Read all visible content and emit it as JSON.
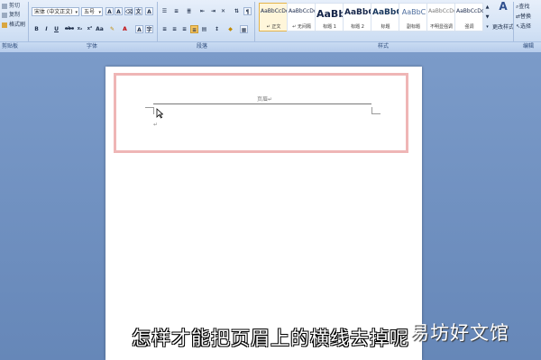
{
  "clipboard": {
    "cut": "剪切",
    "copy": "复制",
    "format_painter": "格式刷",
    "group_label": "剪贴板"
  },
  "font": {
    "family": "宋体 (中文正文)",
    "size": "五号",
    "group_label": "字体",
    "buttons": [
      "B",
      "I",
      "U",
      "abc",
      "x₂",
      "x²",
      "Aa",
      "A",
      "A"
    ]
  },
  "paragraph": {
    "group_label": "段落"
  },
  "styles": {
    "group_label": "样式",
    "items": [
      {
        "sample": "AaBbCcDd",
        "name": "↵ 正文",
        "selected": true
      },
      {
        "sample": "AaBbCcDd",
        "name": "↵ 无间隔",
        "selected": false
      },
      {
        "sample": "AaBb",
        "name": "标题 1",
        "selected": false
      },
      {
        "sample": "AaBbC",
        "name": "标题 2",
        "selected": false
      },
      {
        "sample": "AaBbC",
        "name": "标题",
        "selected": false
      },
      {
        "sample": "AaBbC",
        "name": "副标题",
        "selected": false
      },
      {
        "sample": "AaBbCcDd",
        "name": "不明显强调",
        "selected": false
      },
      {
        "sample": "AaBbCcDd",
        "name": "强调",
        "selected": false
      }
    ],
    "change_styles": "更改样式"
  },
  "editing": {
    "find": "查找",
    "replace": "替换",
    "select": "选择",
    "group_label": "编辑"
  },
  "document": {
    "header_label": "页眉↵",
    "para_mark": "↵"
  },
  "overlay": {
    "subtitle": "怎样才能把页眉上的横线去掉呢",
    "watermark": "易坊好文馆"
  }
}
